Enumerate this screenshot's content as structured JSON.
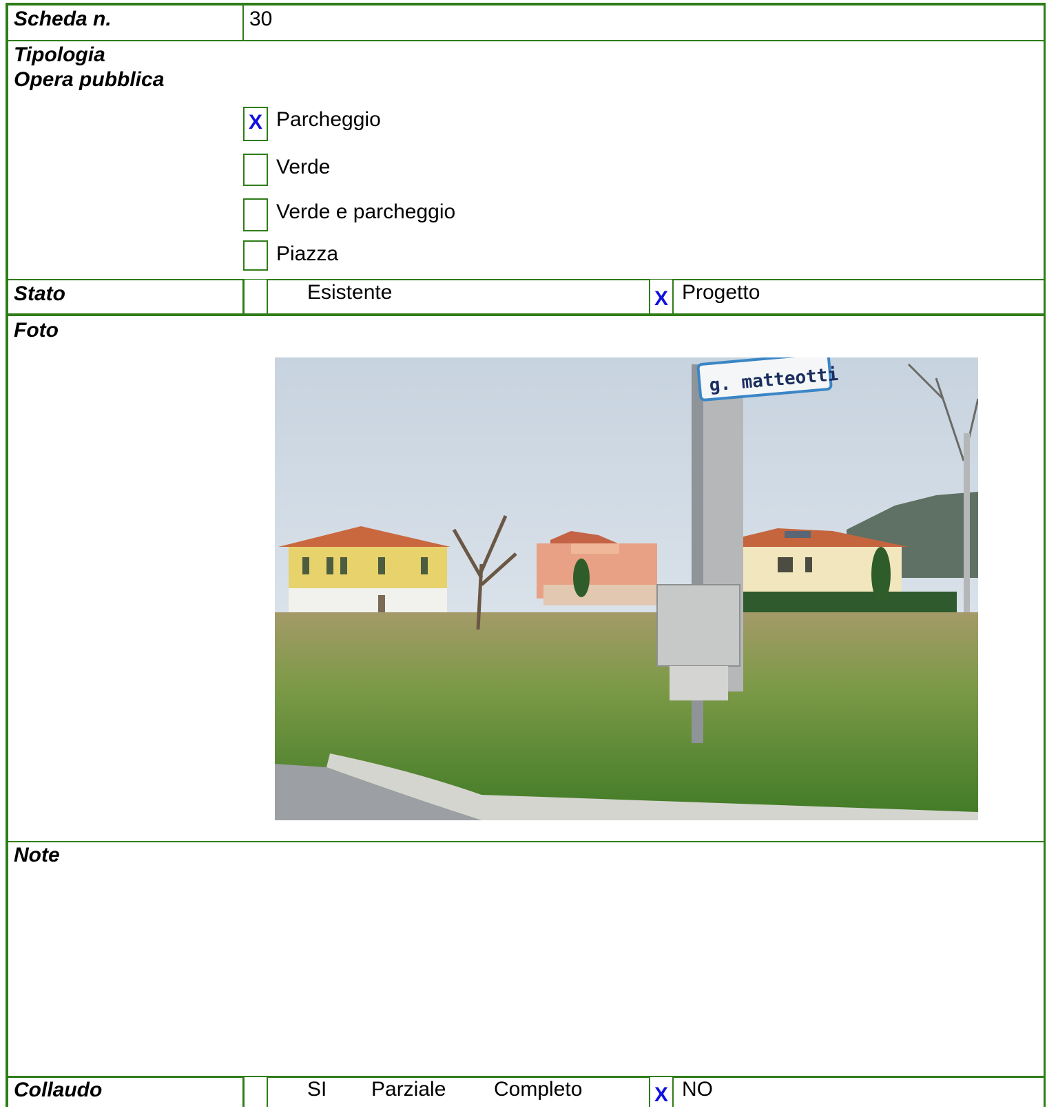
{
  "header": {
    "scheda_label": "Scheda n.",
    "scheda_value": "30"
  },
  "tipologia": {
    "label_line1": "Tipologia",
    "label_line2": "Opera pubblica",
    "options": [
      {
        "label": "Parcheggio",
        "mark": "X"
      },
      {
        "label": "Verde",
        "mark": ""
      },
      {
        "label": "Verde e parcheggio",
        "mark": ""
      },
      {
        "label": "Piazza",
        "mark": ""
      }
    ]
  },
  "stato": {
    "label": "Stato",
    "esistente_label": "Esistente",
    "esistente_mark": "",
    "progetto_label": "Progetto",
    "progetto_mark": "X"
  },
  "foto": {
    "label": "Foto",
    "sign_text": "g. matteotti"
  },
  "note": {
    "label": "Note"
  },
  "collaudo": {
    "label": "Collaudo",
    "si_label": "SI",
    "parziale_label": "Parziale",
    "completo_label": "Completo",
    "si_mark": "",
    "no_label": "NO",
    "no_mark": "X"
  },
  "colors": {
    "border": "#2f7d18",
    "mark": "#1010e0"
  }
}
